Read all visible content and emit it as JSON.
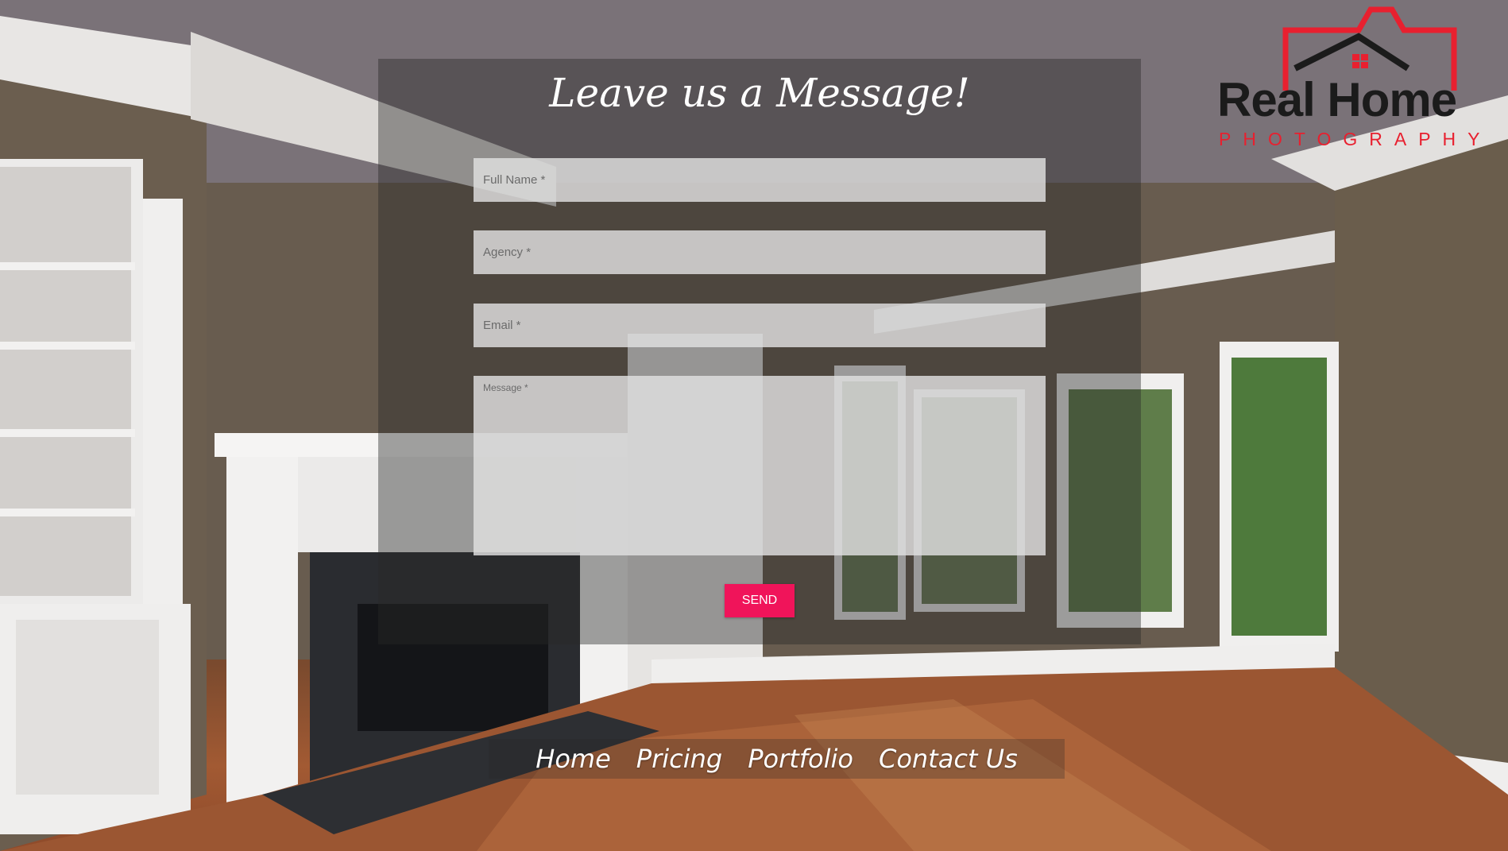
{
  "logo": {
    "title": "Real Home",
    "subtitle": "PHOTOGRAPHY",
    "colors": {
      "red": "#e8202f",
      "dark": "#1b1b1b"
    }
  },
  "form": {
    "title": "Leave us a Message!",
    "fields": [
      {
        "label": "Full Name *",
        "value": ""
      },
      {
        "label": "Agency *",
        "value": ""
      },
      {
        "label": "Email *",
        "value": ""
      },
      {
        "label": "Message *",
        "value": ""
      }
    ],
    "submit_label": "SEND",
    "accent": "#f0145a"
  },
  "nav": {
    "items": [
      {
        "label": "Home"
      },
      {
        "label": "Pricing"
      },
      {
        "label": "Portfolio"
      },
      {
        "label": "Contact Us"
      }
    ]
  }
}
